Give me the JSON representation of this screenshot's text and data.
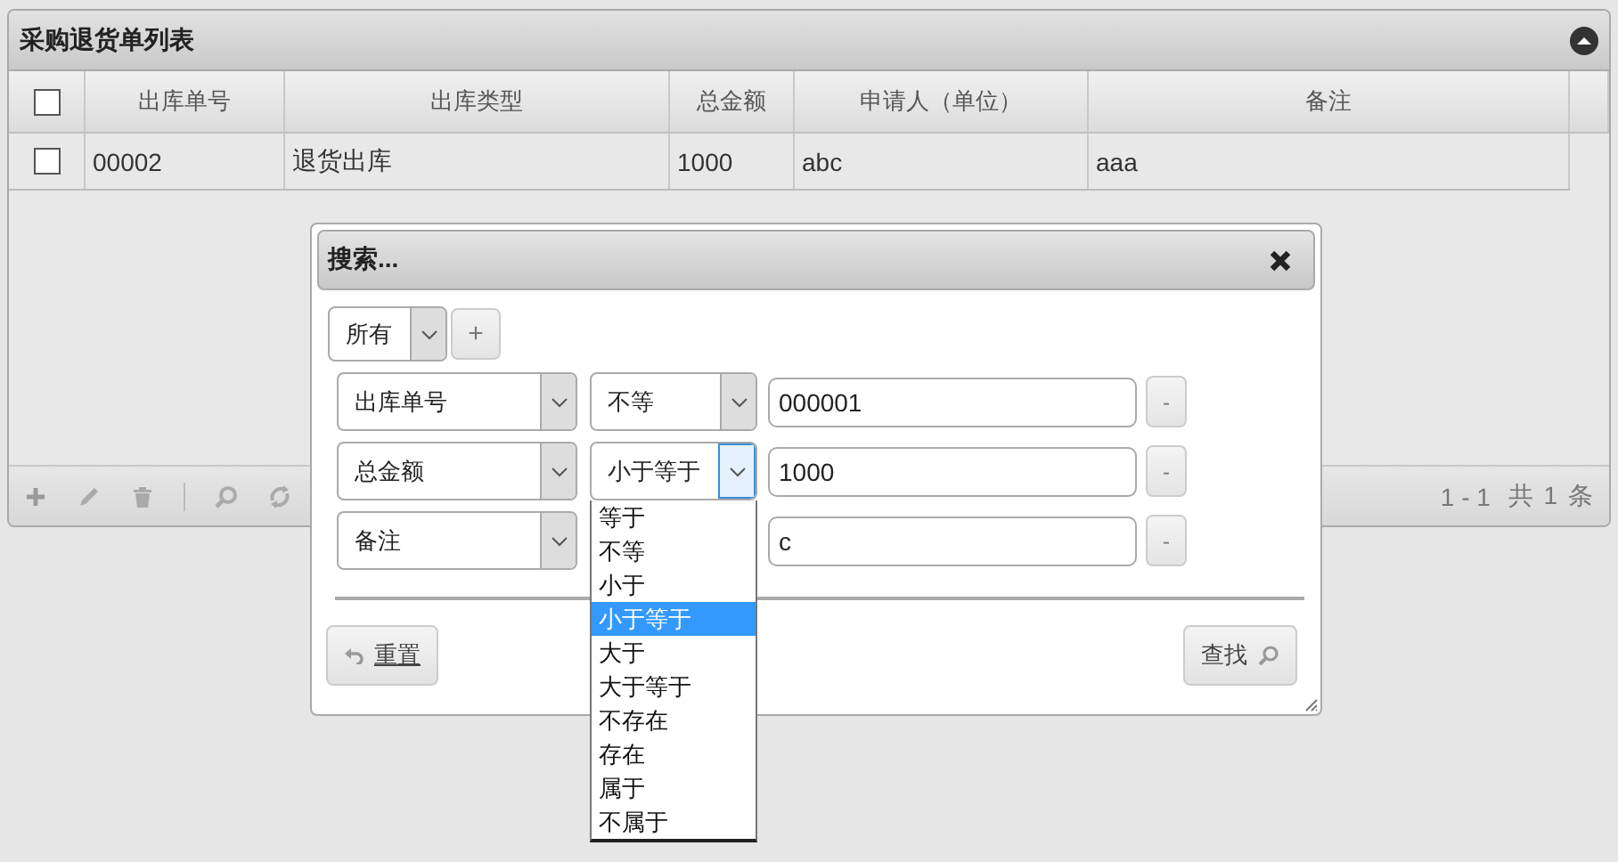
{
  "panel": {
    "title": "采购退货单列表",
    "header_checked": false,
    "columns": [
      "出库单号",
      "出库类型",
      "总金额",
      "申请人（单位）",
      "备注"
    ],
    "rows": [
      {
        "checked": false,
        "cells": [
          "00002",
          "退货出库",
          "1000",
          "abc",
          "aaa"
        ]
      }
    ],
    "pager": "1 - 1",
    "total": "共 1 条"
  },
  "search_dialog": {
    "title": "搜索...",
    "group_op": "所有",
    "add_label": "+",
    "rules": [
      {
        "field": "出库单号",
        "op": "不等",
        "value": "000001",
        "remove_label": "-",
        "open": false
      },
      {
        "field": "总金额",
        "op": "小于等于",
        "value": "1000",
        "remove_label": "-",
        "open": true
      },
      {
        "field": "备注",
        "value": "c",
        "remove_label": "-",
        "open": false
      }
    ],
    "operator_options": [
      {
        "label": "等于",
        "selected": false
      },
      {
        "label": "不等",
        "selected": false
      },
      {
        "label": "小于",
        "selected": false
      },
      {
        "label": "小于等于",
        "selected": true
      },
      {
        "label": "大于",
        "selected": false
      },
      {
        "label": "大于等于",
        "selected": false
      },
      {
        "label": "不存在",
        "selected": false
      },
      {
        "label": "存在",
        "selected": false
      },
      {
        "label": "属于",
        "selected": false
      },
      {
        "label": "不属于",
        "selected": false
      }
    ],
    "reset_label": "重置",
    "find_label": "查找"
  }
}
